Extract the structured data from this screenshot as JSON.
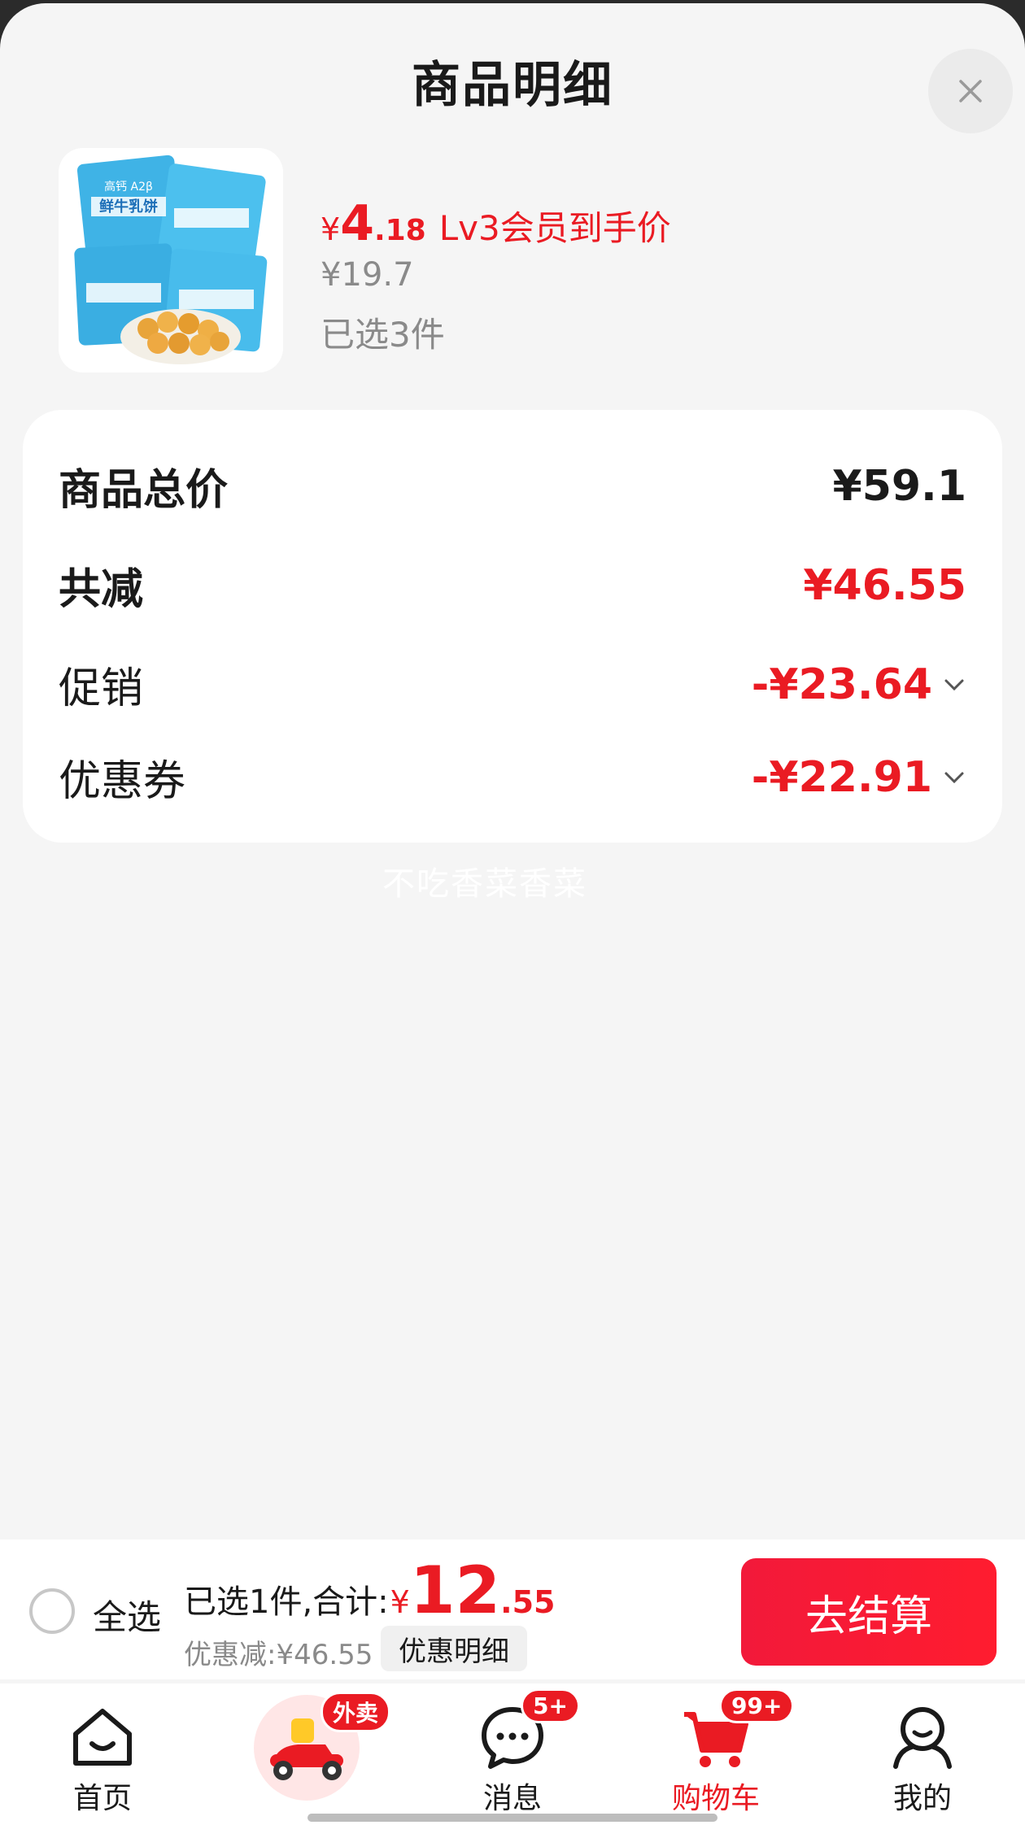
{
  "sheet": {
    "title": "商品明细"
  },
  "product": {
    "price_currency": "¥",
    "price_int": "4",
    "price_dec": ".18",
    "price_tag": "Lv3会员到手价",
    "original_price": "¥19.7",
    "selected_count": "已选3件",
    "image_text": {
      "line1": "高钙 A2β",
      "line2": "鲜牛乳饼"
    }
  },
  "summary": {
    "rows": [
      {
        "label": "商品总价",
        "value": "¥59.1"
      },
      {
        "label": "共减",
        "value": "¥46.55"
      },
      {
        "label": "促销",
        "value": "-¥23.64"
      },
      {
        "label": "优惠券",
        "value": "-¥22.91"
      }
    ]
  },
  "watermark": "不吃香菜香菜",
  "checkout": {
    "select_all": "全选",
    "total_label": "已选1件,合计:",
    "total_currency": "¥",
    "total_int": "12",
    "total_dec": ".55",
    "discount_text": "优惠减:¥46.55",
    "discount_detail": "优惠明细",
    "checkout_button": "去结算"
  },
  "tabbar": {
    "items": [
      {
        "label": "首页",
        "icon": "home-icon"
      },
      {
        "label": "",
        "icon": "delivery-scooter-icon",
        "badge": "外卖"
      },
      {
        "label": "消息",
        "icon": "message-icon",
        "badge": "5+"
      },
      {
        "label": "购物车",
        "icon": "cart-icon",
        "badge": "99+",
        "active": true
      },
      {
        "label": "我的",
        "icon": "profile-icon"
      }
    ]
  },
  "colors": {
    "accent": "#ea1b23",
    "background": "#f5f5f5",
    "muted": "#8a8a8a"
  }
}
